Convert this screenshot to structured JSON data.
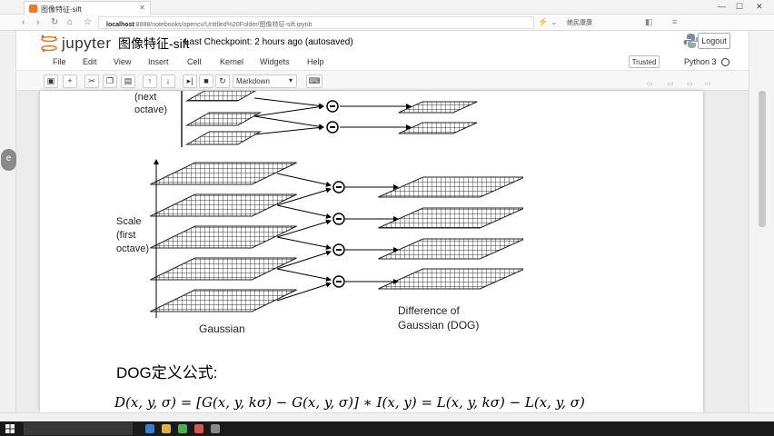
{
  "browser": {
    "tab_title": "图像特征-sift",
    "tab_close": "✕",
    "address_host": "localhost",
    "address_rest": ":8888/notebooks/opencv/Untitled%20Folder/图像特征-sift.ipynb",
    "user_label": "绝民康康",
    "window_controls": [
      "—",
      "☐",
      "✕"
    ]
  },
  "jupyter": {
    "brand": "jupyter",
    "notebook_name": "图像特征-sift",
    "checkpoint": "Last Checkpoint: 2 hours ago (autosaved)",
    "logout_label": "Logout",
    "menu": [
      "File",
      "Edit",
      "View",
      "Insert",
      "Cell",
      "Kernel",
      "Widgets",
      "Help"
    ],
    "trusted_label": "Trusted",
    "kernel_name": "Python 3",
    "cell_type": "Markdown",
    "toolbar_icons": [
      "save-icon",
      "plus-icon",
      "cut-icon",
      "copy-icon",
      "paste-icon",
      "arrow-up-icon",
      "arrow-down-icon",
      "step-icon",
      "stop-icon",
      "restart-icon",
      "keyboard-icon"
    ]
  },
  "figure": {
    "labels": {
      "next_1": "(next",
      "next_2": "octave)",
      "scale_1": "Scale",
      "scale_2": "(first",
      "scale_3": "octave)",
      "gaussian": "Gaussian",
      "dog_1": "Difference of",
      "dog_2": "Gaussian (DOG)"
    }
  },
  "content": {
    "dog_heading": "DOG定义公式:",
    "formula": "D(x, y, σ) = [G(x, y, kσ) − G(x, y, σ)] ∗ I(x, y) = L(x, y, kσ) − L(x, y, σ)"
  },
  "colors": {
    "jupyter_orange": "#f37626",
    "grid_plane": "#5a5a5a"
  }
}
